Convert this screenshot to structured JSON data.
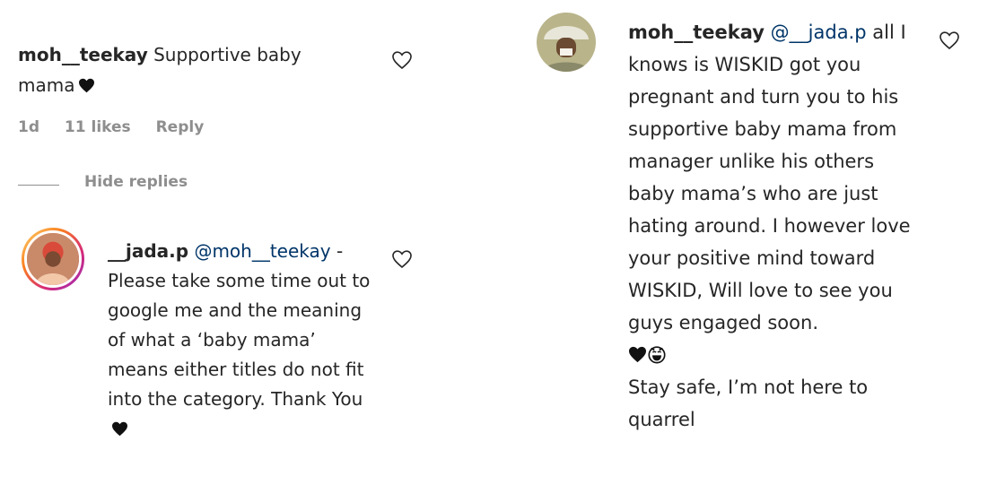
{
  "left": {
    "comment": {
      "username": "moh__teekay",
      "text": "Supportive baby mama",
      "time": "1d",
      "likes": "11 likes",
      "reply_label": "Reply"
    },
    "hide_replies_label": "Hide replies",
    "reply": {
      "username": "__jada.p",
      "mention": "@moh__teekay",
      "text": " - Please take some time out to google me and the meaning of what a ‘baby mama’ means either titles do not fit into the category. Thank You"
    }
  },
  "right": {
    "reply": {
      "username": "moh__teekay",
      "mention": "@__jada.p",
      "text": "all I knows is WISKID got you pregnant and turn you to his supportive baby mama from manager unlike his others baby mama’s who are just hating around. I however love your positive mind toward WISKID, Will love to see you guys engaged soon.",
      "text2": "Stay safe, I’m not here to quarrel"
    }
  },
  "icons": [
    "heart-outline-icon",
    "black-heart-icon",
    "laughing-emoji-icon"
  ],
  "colors": {
    "text": "#262626",
    "muted": "#8e8e8e",
    "mention": "#003569"
  }
}
